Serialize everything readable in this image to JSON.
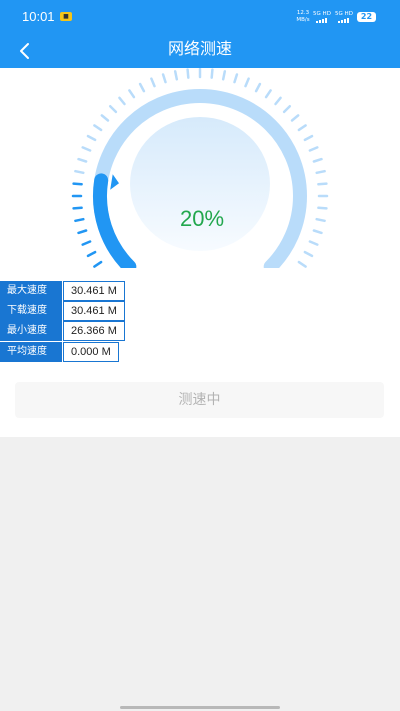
{
  "status_bar": {
    "time": "10:01",
    "notification_badge": "■",
    "net_speed_value": "12.3",
    "net_speed_unit": "MB/s",
    "signal1_label": "5G HD",
    "signal2_label": "5G HD",
    "battery": "22"
  },
  "header": {
    "title": "网络测速",
    "back_icon": "chevron-left-icon"
  },
  "gauge": {
    "progress_percent": 20,
    "display_text": "20%",
    "colors": {
      "active": "#2196f3",
      "track": "#b9dcfa",
      "inner": "#eaf4fd",
      "value_text": "#22a74d"
    }
  },
  "stats": [
    {
      "label": "最大速度",
      "value": "30.461 M"
    },
    {
      "label": "下载速度",
      "value": "30.461 M"
    },
    {
      "label": "最小速度",
      "value": "26.366 M"
    },
    {
      "label": "平均速度",
      "value": "0.000 M"
    }
  ],
  "test_button": {
    "label": "测速中"
  },
  "colors": {
    "primary": "#2196f3",
    "label_bg": "#1976d2",
    "page_bg": "#f0f0f0"
  }
}
